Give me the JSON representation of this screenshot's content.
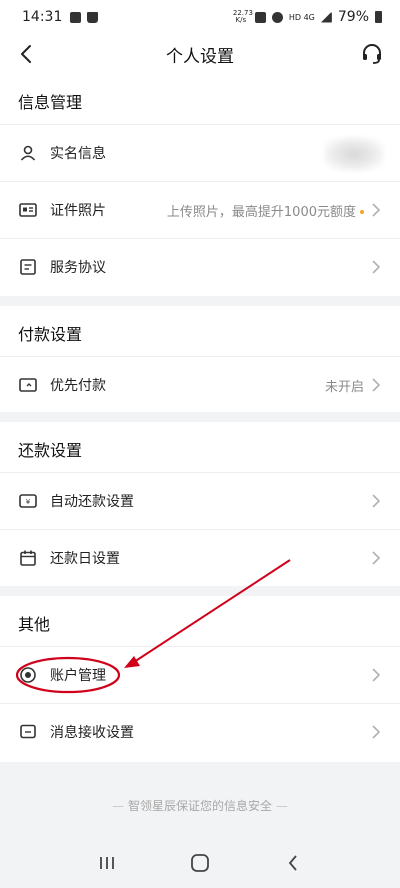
{
  "status_bar": {
    "time": "14:31",
    "net_speed_top": "22.73",
    "net_speed_bottom": "K/s",
    "network": "HD 4G",
    "battery": "79%"
  },
  "header": {
    "title": "个人设置"
  },
  "sections": [
    {
      "title": "信息管理",
      "rows": [
        {
          "label": "实名信息",
          "value": "",
          "icon": "person-icon"
        },
        {
          "label": "证件照片",
          "value": "上传照片，最高提升1000元额度",
          "icon": "id-card-icon"
        },
        {
          "label": "服务协议",
          "value": "",
          "icon": "document-icon"
        }
      ]
    },
    {
      "title": "付款设置",
      "rows": [
        {
          "label": "优先付款",
          "value": "未开启",
          "icon": "wallet-icon"
        }
      ]
    },
    {
      "title": "还款设置",
      "rows": [
        {
          "label": "自动还款设置",
          "value": "",
          "icon": "auto-repay-icon"
        },
        {
          "label": "还款日设置",
          "value": "",
          "icon": "calendar-icon"
        }
      ]
    },
    {
      "title": "其他",
      "rows": [
        {
          "label": "账户管理",
          "value": "",
          "icon": "account-icon"
        },
        {
          "label": "消息接收设置",
          "value": "",
          "icon": "message-icon"
        }
      ]
    }
  ],
  "footer": {
    "text": "智领星辰保证您的信息安全"
  },
  "colors": {
    "annotation": "#d0021b",
    "background": "#f2f3f5"
  }
}
